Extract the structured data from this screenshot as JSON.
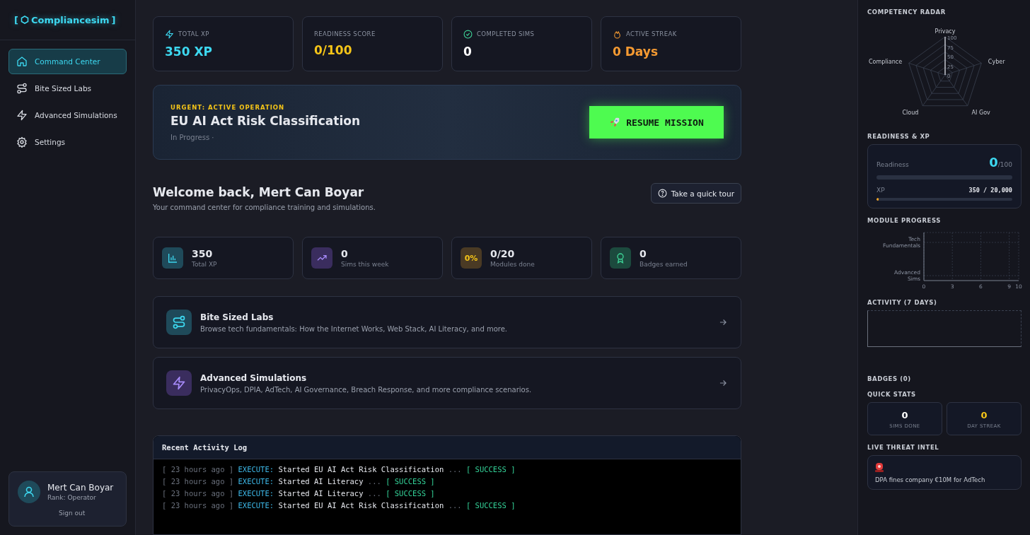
{
  "sidebar": {
    "logo": {
      "open": "[",
      "name": "Compliancesim",
      "close": "]"
    },
    "items": [
      {
        "label": "Command Center",
        "selected": true
      },
      {
        "label": "Bite Sized Labs",
        "selected": false
      },
      {
        "label": "Advanced Simulations",
        "selected": false
      },
      {
        "label": "Settings",
        "selected": false
      }
    ],
    "user": {
      "name": "Mert Can Boyar",
      "rank": "Rank: Operator",
      "sign_out": "Sign out"
    }
  },
  "top_stats": [
    {
      "label": "TOTAL XP",
      "value": "350 XP",
      "color": "#3dd8f0"
    },
    {
      "label": "READINESS SCORE",
      "value": "0/100",
      "color": "#f5c518"
    },
    {
      "label": "COMPLETED SIMS",
      "value": "0",
      "color": "#ffffff"
    },
    {
      "label": "ACTIVE STREAK",
      "value": "0 Days",
      "color": "#f59a32"
    }
  ],
  "mission": {
    "eyebrow": "URGENT: ACTIVE OPERATION",
    "title": "EU AI Act Risk Classification",
    "status": "In Progress ·",
    "button": "RESUME MISSION"
  },
  "welcome": {
    "title": "Welcome back, Mert Can Boyar",
    "subtitle": "Your command center for compliance training and simulations.",
    "tour": "Take a quick tour"
  },
  "mini_stats": [
    {
      "kind": "chart",
      "value": "350",
      "label": "Total XP",
      "color": "#1f4a5a"
    },
    {
      "kind": "trend",
      "value": "0",
      "label": "Sims this week",
      "color": "#3a2d5e"
    },
    {
      "kind": "percent",
      "badge": "0%",
      "value": "0/20",
      "label": "Modules done",
      "color": "#4a3a24"
    },
    {
      "kind": "award",
      "value": "0",
      "label": "Badges earned",
      "color": "#1c4a3e"
    }
  ],
  "links": [
    {
      "kind": "route",
      "title": "Bite Sized Labs",
      "description": "Browse tech fundamentals: How the Internet Works, Web Stack, AI Literacy, and more.",
      "color": "#1f4a5a"
    },
    {
      "kind": "bolt",
      "title": "Advanced Simulations",
      "description": "PrivacyOps, DPIA, AdTech, AI Governance, Breach Response, and more compliance scenarios.",
      "color": "#3a2d5e"
    }
  ],
  "log": {
    "title": "Recent Activity Log",
    "lines": [
      {
        "time": "[ 23 hours ago ]",
        "action": "EXECUTE:",
        "message": "Started EU AI Act Risk Classification",
        "dots": "...",
        "status": "[ SUCCESS ]"
      },
      {
        "time": "[ 23 hours ago ]",
        "action": "EXECUTE:",
        "message": "Started AI Literacy",
        "dots": "...",
        "status": "[ SUCCESS ]"
      },
      {
        "time": "[ 23 hours ago ]",
        "action": "EXECUTE:",
        "message": "Started AI Literacy",
        "dots": "...",
        "status": "[ SUCCESS ]"
      },
      {
        "time": "[ 23 hours ago ]",
        "action": "EXECUTE:",
        "message": "Started EU AI Act Risk Classification",
        "dots": "...",
        "status": "[ SUCCESS ]"
      }
    ]
  },
  "right_panel": {
    "radar": {
      "title": "COMPETENCY RADAR",
      "axes": [
        "Privacy",
        "Cyber",
        "AI Gov",
        "Cloud",
        "Compliance"
      ],
      "ticks": [
        "100",
        "75",
        "50",
        "25",
        "0"
      ]
    },
    "readiness": {
      "title": "READINESS & XP",
      "label": "Readiness",
      "value": "0",
      "max": "/100"
    },
    "xp": {
      "label": "XP",
      "value": "350 / 20,000",
      "level": 0.0175
    },
    "modules": {
      "title": "MODULE PROGRESS",
      "chart_data": {
        "type": "bar",
        "orientation": "horizontal",
        "categories": [
          "Tech Fundamentals",
          "Advanced Sims"
        ],
        "values": [
          0,
          0
        ],
        "xlim": [
          0,
          10
        ],
        "xticks": [
          0,
          3,
          6,
          9,
          10
        ],
        "grid": true
      }
    },
    "activity": {
      "title": "ACTIVITY (7 DAYS)"
    },
    "badges": {
      "title": "BADGES (0)"
    },
    "quick_stats": {
      "title": "QUICK STATS",
      "items": [
        {
          "value": "0",
          "label": "SIMS DONE",
          "color": "#ffffff"
        },
        {
          "value": "0",
          "label": "DAY STREAK",
          "color": "#f5c518"
        }
      ]
    },
    "threat": {
      "title": "LIVE THREAT INTEL",
      "text": "DPA fines company €10M for AdTech"
    }
  }
}
